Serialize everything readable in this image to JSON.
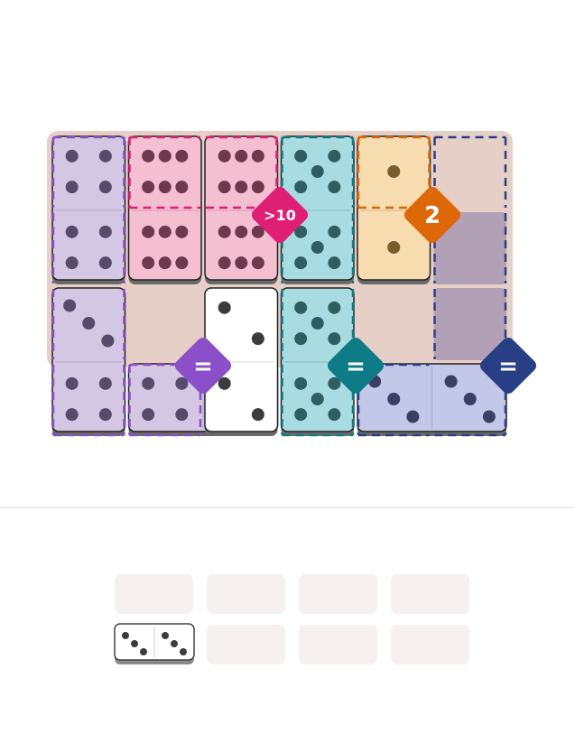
{
  "game": {
    "board_background": "#e6cfc6",
    "colors": {
      "lavender_fill": "#d4c7e4",
      "lavender_dot": "#574a6b",
      "lavender_border": "#8a4fc9",
      "pink_fill": "#f5bfd2",
      "pink_dot": "#6d3a4d",
      "pink_border": "#de1f73",
      "teal_fill": "#a9dce0",
      "teal_dot": "#2e5e60",
      "teal_border": "#0e7c86",
      "orange_fill": "#f6dcae",
      "orange_dot": "#7a5b2a",
      "orange_border": "#de6708",
      "blue_fill": "#c3c7e8",
      "blue_dot": "#3b3f63",
      "blue_border": "#283f86",
      "empty_region": "#b2a1b6",
      "plain_fill": "#ffffff",
      "plain_dot": "#3c3c3c"
    },
    "placed_dominoes": [
      {
        "pips": [
          4,
          4
        ],
        "region": "lavender",
        "orientation": "vertical"
      },
      {
        "pips": [
          6,
          6
        ],
        "region": "pink",
        "orientation": "vertical"
      },
      {
        "pips": [
          6,
          6
        ],
        "region": "pink",
        "orientation": "vertical"
      },
      {
        "pips": [
          5,
          5
        ],
        "region": "teal",
        "orientation": "vertical"
      },
      {
        "pips": [
          1,
          1
        ],
        "region": "orange",
        "orientation": "vertical"
      },
      {
        "pips": [
          3,
          4
        ],
        "region": "lavender",
        "orientation": "vertical"
      },
      {
        "pips": [
          4,
          4
        ],
        "region": "lavender",
        "orientation": "horizontal"
      },
      {
        "pips": [
          2,
          2
        ],
        "region": "plain",
        "orientation": "vertical"
      },
      {
        "pips": [
          5,
          5
        ],
        "region": "teal",
        "orientation": "vertical"
      },
      {
        "pips": [
          3,
          3
        ],
        "region": "blue",
        "orientation": "horizontal"
      }
    ],
    "constraints": [
      {
        "label": ">10",
        "color": "#de1f73"
      },
      {
        "label": "2",
        "color": "#de6708"
      },
      {
        "label": "=",
        "color": "#8a4fc9"
      },
      {
        "label": "=",
        "color": "#0e7c86"
      },
      {
        "label": "=",
        "color": "#283f86"
      }
    ]
  },
  "tray": {
    "slot_color": "#f6f1f0",
    "remaining_domino": {
      "pips": [
        3,
        3
      ]
    }
  }
}
